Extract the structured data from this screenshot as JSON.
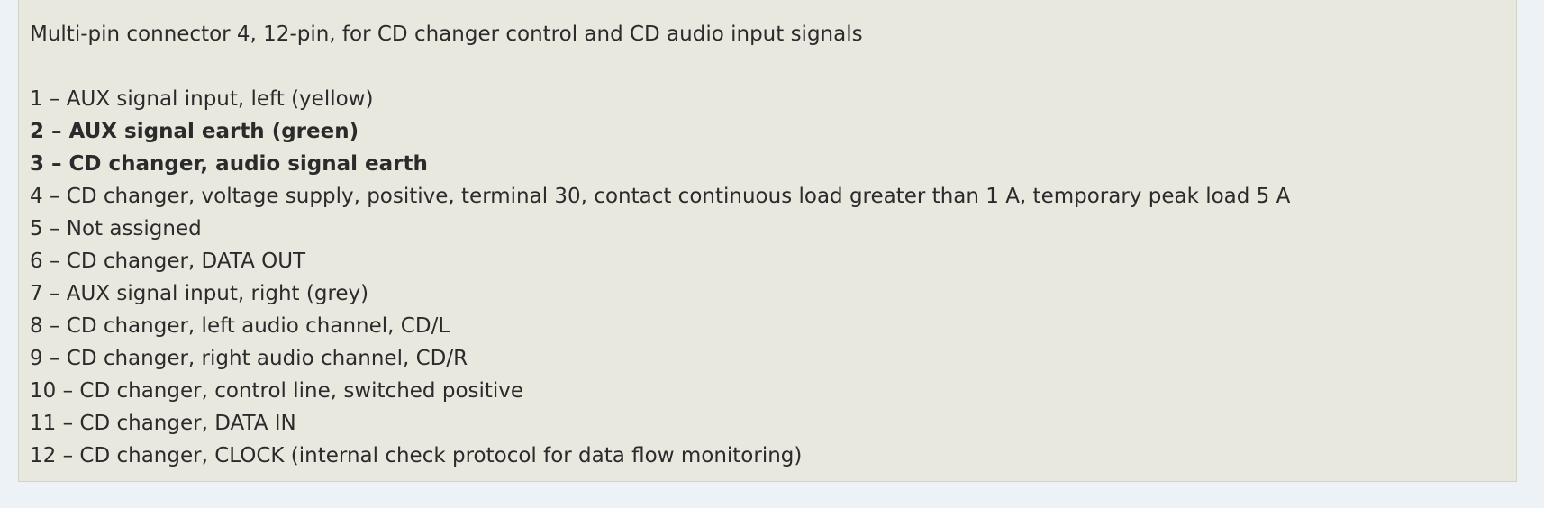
{
  "heading": "Multi-pin connector 4, 12-pin, for CD changer control and CD audio input signals",
  "pins": [
    {
      "text": "1 – AUX signal input, left (yellow)",
      "bold": false
    },
    {
      "text": "2 – AUX signal earth (green)",
      "bold": true
    },
    {
      "text": "3 – CD changer, audio signal earth",
      "bold": true
    },
    {
      "text": "4 – CD changer, voltage supply, positive, terminal 30, contact continuous load greater than 1 A, temporary peak load 5 A",
      "bold": false
    },
    {
      "text": "5 – Not assigned",
      "bold": false
    },
    {
      "text": "6 – CD changer, DATA OUT",
      "bold": false
    },
    {
      "text": "7 – AUX signal input, right (grey)",
      "bold": false
    },
    {
      "text": "8 – CD changer, left audio channel, CD/L",
      "bold": false
    },
    {
      "text": "9 – CD changer, right audio channel, CD/R",
      "bold": false
    },
    {
      "text": "10 – CD changer, control line, switched positive",
      "bold": false
    },
    {
      "text": "11 – CD changer, DATA IN",
      "bold": false
    },
    {
      "text": "12 – CD changer, CLOCK (internal check protocol for data flow monitoring)",
      "bold": false
    }
  ]
}
